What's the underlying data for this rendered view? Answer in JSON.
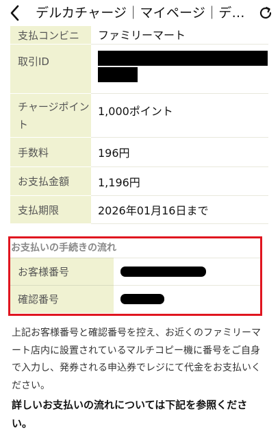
{
  "header": {
    "title": "デルカチャージ｜マイページ｜デ…"
  },
  "icons": {
    "back": "chevron-left-icon",
    "reload": "reload-icon"
  },
  "details": {
    "rows": [
      {
        "label": "支払コンビニ",
        "value": "ファミリーマート"
      },
      {
        "label": "取引ID",
        "value": ""
      },
      {
        "label": "チャージポイント",
        "value": "1,000ポイント"
      },
      {
        "label": "手数料",
        "value": "196円"
      },
      {
        "label": "お支払金額",
        "value": "1,196円"
      },
      {
        "label": "支払期限",
        "value": "2026年01月16日まで"
      }
    ]
  },
  "payment_flow": {
    "title": "お支払いの手続きの流れ",
    "customer_number_label": "お客様番号",
    "confirmation_number_label": "確認番号",
    "accent_color": "#e0151f"
  },
  "instructions": {
    "text": "上記お客様番号と確認番号を控え、お近くのファミリーマート店内に設置されているマルチコピー機に番号をご自身で入力し、発券される申込券でレジにて代金をお支払いください。",
    "bold_text": "詳しいお支払いの流れについては下記を参照ください。"
  }
}
